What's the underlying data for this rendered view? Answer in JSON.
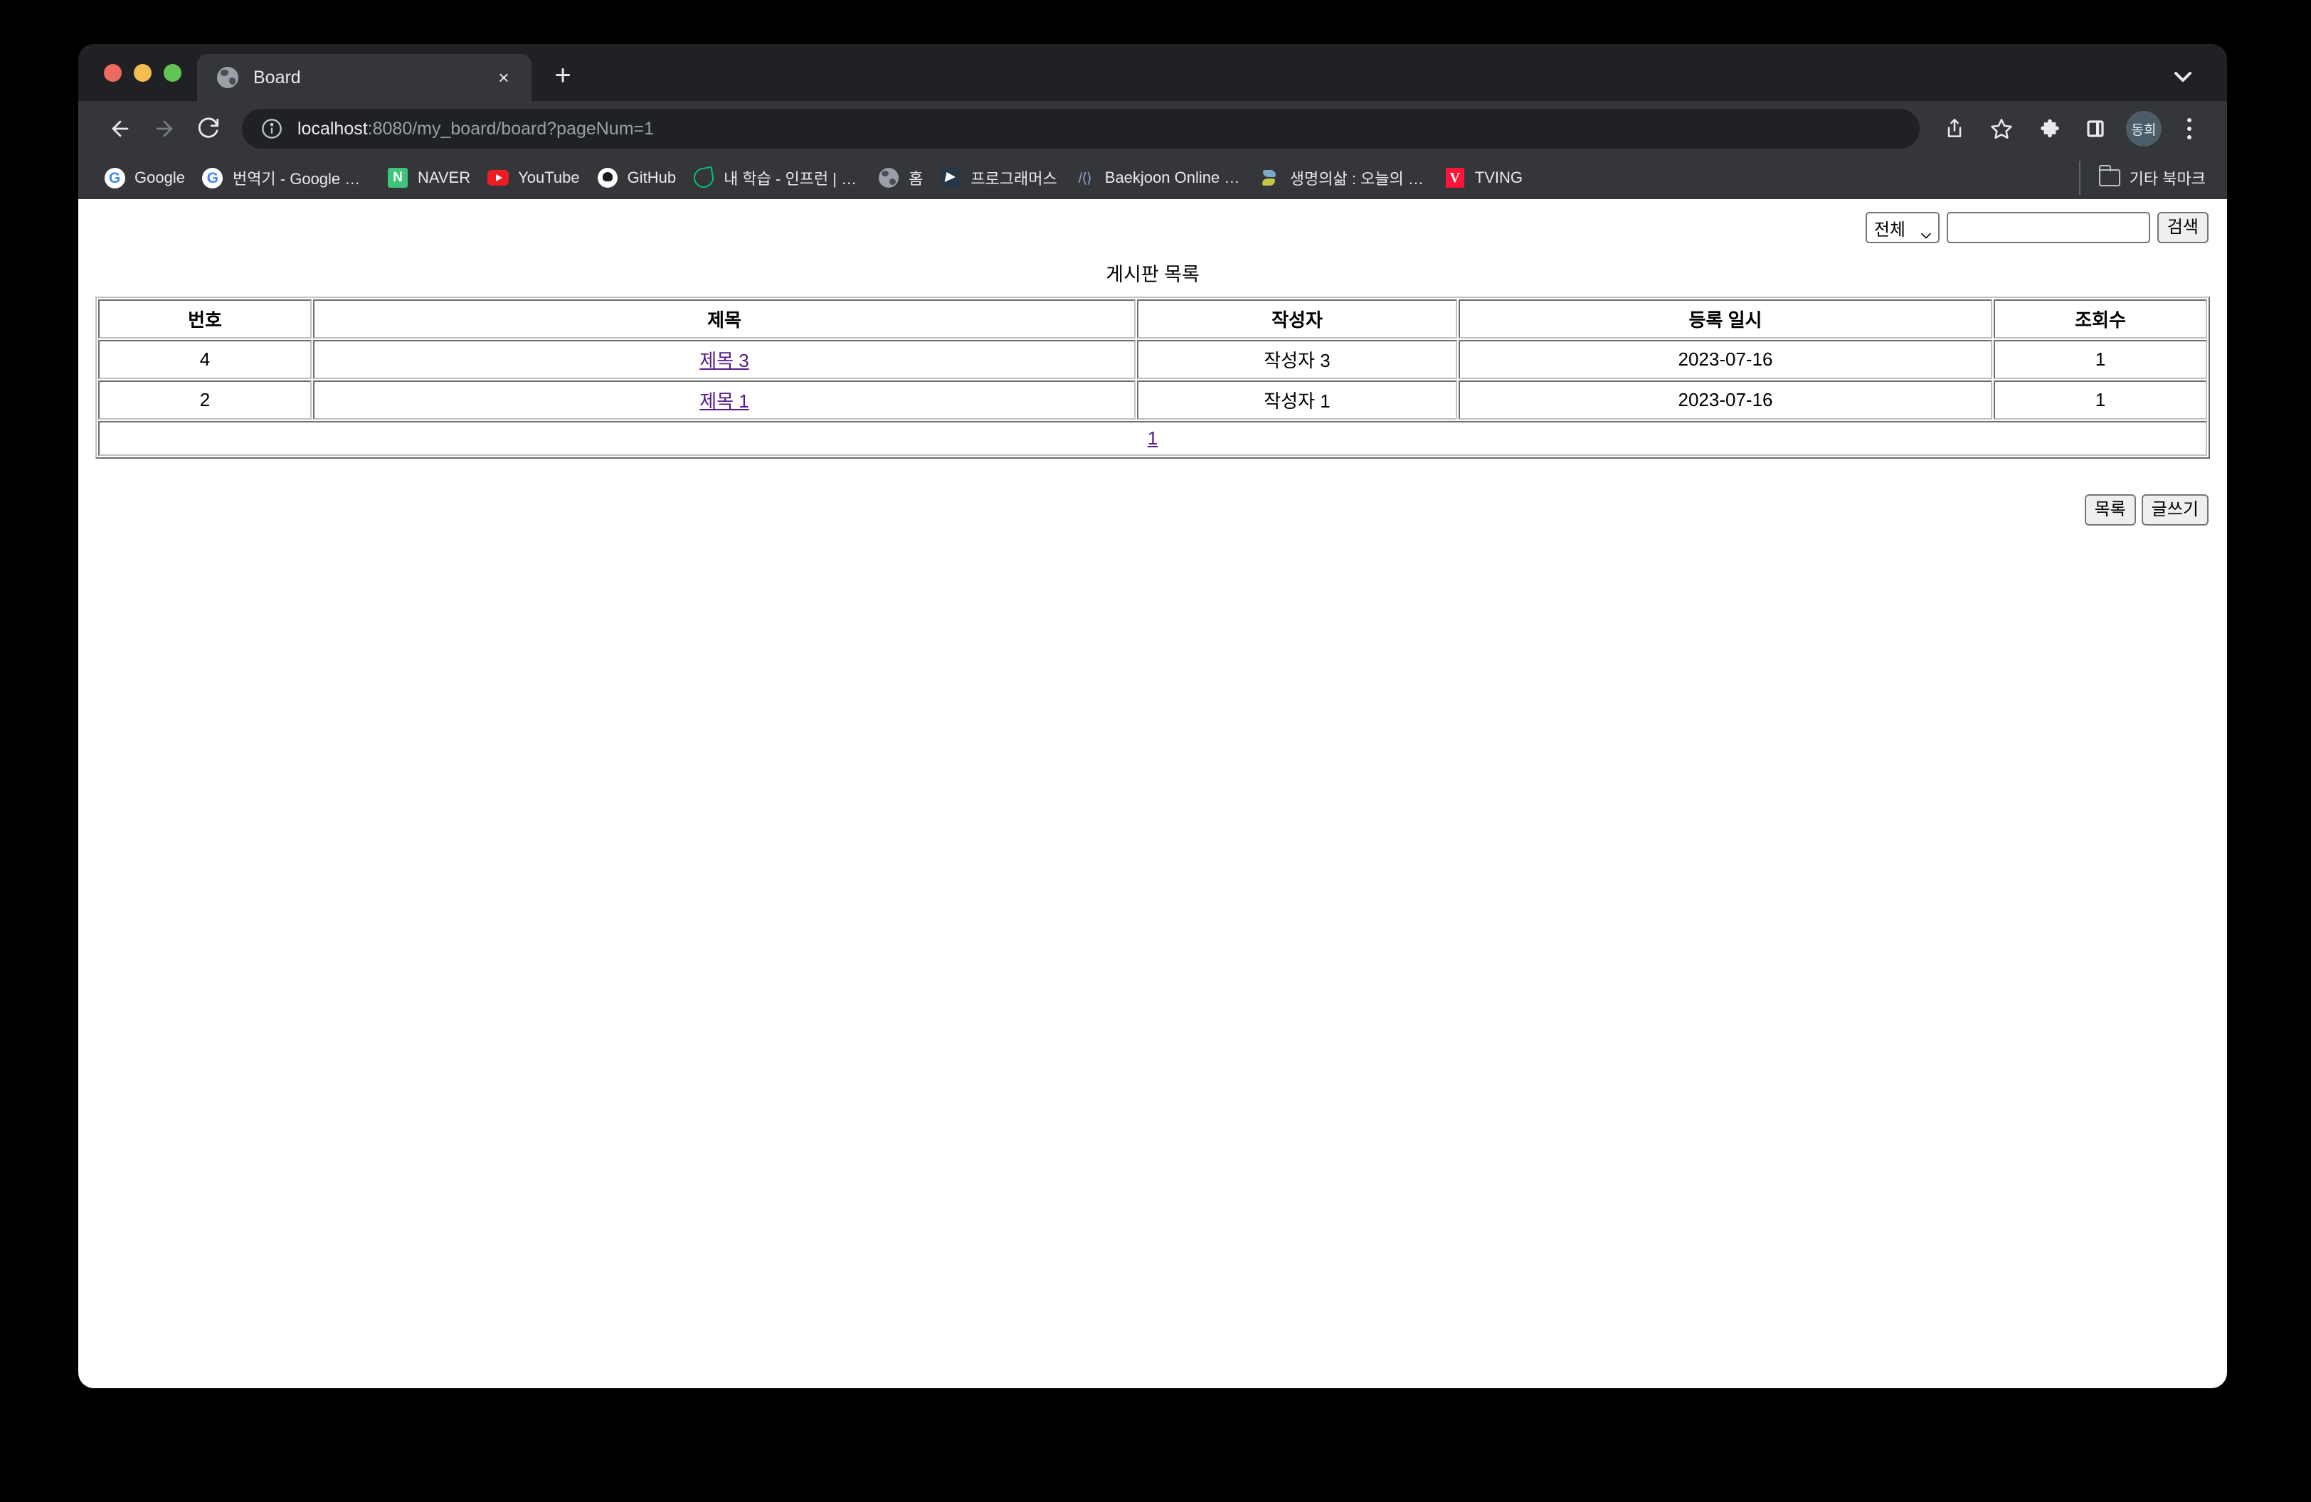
{
  "browser": {
    "tab": {
      "title": "Board",
      "favicon": "globe-icon",
      "close": "×"
    },
    "new_tab_label": "+",
    "url": {
      "host": "localhost",
      "path": ":8080/my_board/board?pageNum=1",
      "full": "localhost:8080/my_board/board?pageNum=1"
    },
    "profile_initials": "동희",
    "bookmarks": [
      {
        "label": "Google",
        "icon": "google-icon",
        "glyph": "G"
      },
      {
        "label": "번역기 - Google 검색",
        "icon": "google-icon",
        "glyph": "G"
      },
      {
        "label": "NAVER",
        "icon": "naver-icon",
        "glyph": "N"
      },
      {
        "label": "YouTube",
        "icon": "youtube-icon",
        "glyph": ""
      },
      {
        "label": "GitHub",
        "icon": "github-icon",
        "glyph": ""
      },
      {
        "label": "내 학습 - 인프런 | 마...",
        "icon": "inflearn-icon",
        "glyph": ""
      },
      {
        "label": "홈",
        "icon": "globe-icon",
        "glyph": ""
      },
      {
        "label": "프로그래머스",
        "icon": "programmers-icon",
        "glyph": ""
      },
      {
        "label": "Baekjoon Online J...",
        "icon": "baekjoon-icon",
        "glyph": "/⟨⟩"
      },
      {
        "label": "생명의삶 : 오늘의 QT...",
        "icon": "qt-icon",
        "glyph": ""
      },
      {
        "label": "TVING",
        "icon": "tving-icon",
        "glyph": "V"
      }
    ],
    "other_bookmarks_label": "기타 북마크"
  },
  "page": {
    "title": "게시판 목록",
    "search": {
      "type_selected": "전체",
      "type_options": [
        "전체"
      ],
      "keyword_value": "",
      "keyword_placeholder": "",
      "submit_label": "검색"
    },
    "table": {
      "headers": [
        "번호",
        "제목",
        "작성자",
        "등록 일시",
        "조회수"
      ],
      "rows": [
        {
          "no": "4",
          "title": "제목 3",
          "writer": "작성자 3",
          "date": "2023-07-16",
          "views": "1"
        },
        {
          "no": "2",
          "title": "제목 1",
          "writer": "작성자 1",
          "date": "2023-07-16",
          "views": "1"
        }
      ],
      "pagination": [
        "1"
      ],
      "current_page": "1"
    },
    "buttons": {
      "list_label": "목록",
      "write_label": "글쓰기"
    },
    "link_color": "#551a8b"
  }
}
